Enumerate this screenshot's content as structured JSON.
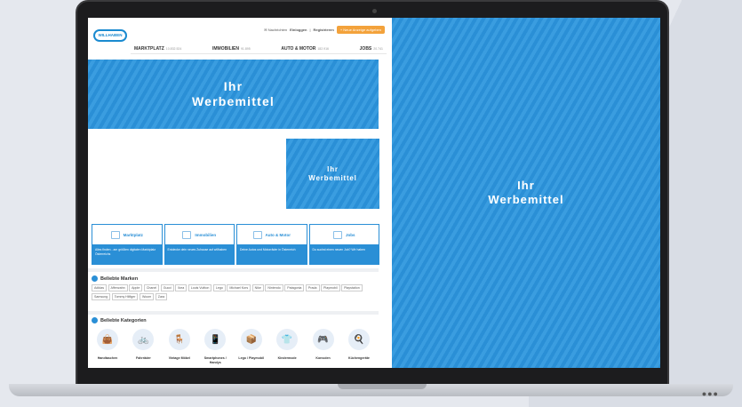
{
  "header": {
    "logo_text": "WILLHABEN",
    "messages": "Nachrichten",
    "login": "Einloggen",
    "separator": "|",
    "register": "Registrieren",
    "post_ad_button": "+ Neue Anzeige aufgeben"
  },
  "nav": [
    {
      "label": "MARKTPLATZ",
      "count": "10.832.524"
    },
    {
      "label": "IMMOBILIEN",
      "count": "91.895"
    },
    {
      "label": "AUTO & MOTOR",
      "count": "182.916"
    },
    {
      "label": "JOBS",
      "count": "20.741"
    }
  ],
  "ads": {
    "top_line1": "Ihr",
    "top_line2": "Werbemittel",
    "mid_line1": "Ihr",
    "mid_line2": "Werbemittel",
    "right_line1": "Ihr",
    "right_line2": "Werbemittel"
  },
  "cards": [
    {
      "title": "Marktplatz",
      "text": "Alles finden - am größten digitalen Marktplatz Österreichs"
    },
    {
      "title": "Immobilien",
      "text": "Entdecke dein neues Zuhause auf willhaben"
    },
    {
      "title": "Auto & Motor",
      "text": "Deine Autos und Motorräder in Österreich"
    },
    {
      "title": "Jobs",
      "text": "Du suchst einen neuen Job? Wir haben"
    }
  ],
  "brands": {
    "title": "Beliebte Marken",
    "tags": [
      "Adidas",
      "Affenzahn",
      "Apple",
      "Chanel",
      "Gucci",
      "Ikea",
      "Louis Vuitton",
      "Lego",
      "Michael Kors",
      "Nike",
      "Nintendo",
      "Patagonia",
      "Prada",
      "Playmobil",
      "Playstation",
      "Samsung",
      "Tommy Hilfiger",
      "Woom",
      "Zara"
    ]
  },
  "categories": {
    "title": "Beliebte Kategorien",
    "items": [
      {
        "label": "Handtaschen",
        "icon": "handbag-icon"
      },
      {
        "label": "Fahrräder",
        "icon": "bicycle-icon"
      },
      {
        "label": "Vintage Möbel",
        "icon": "armchair-icon"
      },
      {
        "label": "Smartphones / Handys",
        "icon": "smartphone-icon"
      },
      {
        "label": "Lego / Playmobil",
        "icon": "toy-box-icon"
      },
      {
        "label": "Kindermode",
        "icon": "kids-clothes-icon"
      },
      {
        "label": "Konsolen",
        "icon": "gamepad-icon"
      },
      {
        "label": "Küchengeräte",
        "icon": "kitchen-appliance-icon"
      }
    ]
  },
  "laptop_dots": "●●●"
}
